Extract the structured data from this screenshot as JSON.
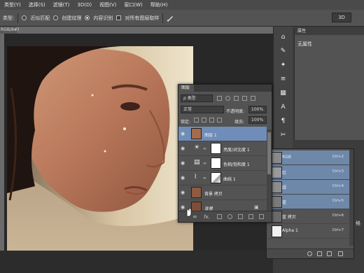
{
  "menu": [
    "类型(Y)",
    "选择(S)",
    "滤镜(T)",
    "3D(D)",
    "视图(V)",
    "窗口(W)",
    "帮助(H)"
  ],
  "options": {
    "type_label": "类型:",
    "opt1": "近似匹配",
    "opt2": "创建纹理",
    "opt3": "内容识别",
    "opt4": "对所有图层取样",
    "mode": "3D"
  },
  "doc_tab": "RGB/8#)",
  "properties": {
    "title": "属性",
    "empty": "无属性"
  },
  "layers_panel": {
    "tab": "图层",
    "filter": "ρ 类型",
    "blend_mode": "正常",
    "opacity_label": "不透明度:",
    "opacity_value": "100%",
    "lock_label": "锁定:",
    "fill_label": "填充:",
    "fill_value": "100%",
    "layers": [
      {
        "name": "图层 1",
        "selected": true,
        "kind": "pixel"
      },
      {
        "name": "亮度/对比度 1",
        "selected": false,
        "kind": "adjust-sun"
      },
      {
        "name": "色相/饱和度 1",
        "selected": false,
        "kind": "adjust-hue"
      },
      {
        "name": "曲线 1",
        "selected": false,
        "kind": "adjust-curve"
      },
      {
        "name": "背景 拷贝",
        "selected": false,
        "kind": "pixel"
      },
      {
        "name": "背景",
        "selected": false,
        "kind": "background"
      }
    ],
    "footer_fx": "fx."
  },
  "channels_panel": {
    "channels": [
      {
        "name": "RGB",
        "shortcut": "Ctrl+2",
        "selected": true
      },
      {
        "name": "红",
        "shortcut": "Ctrl+3",
        "selected": true
      },
      {
        "name": "绿",
        "shortcut": "Ctrl+4",
        "selected": true
      },
      {
        "name": "蓝",
        "shortcut": "Ctrl+5",
        "selected": true
      },
      {
        "name": "蓝 拷贝",
        "shortcut": "Ctrl+6",
        "selected": false
      },
      {
        "name": "Alpha 1",
        "shortcut": "Ctrl+7",
        "selected": false
      }
    ]
  },
  "side_text": "格",
  "colors": {
    "selection": "#6f8db8",
    "panel": "#535353",
    "dark": "#3c3c3c"
  }
}
